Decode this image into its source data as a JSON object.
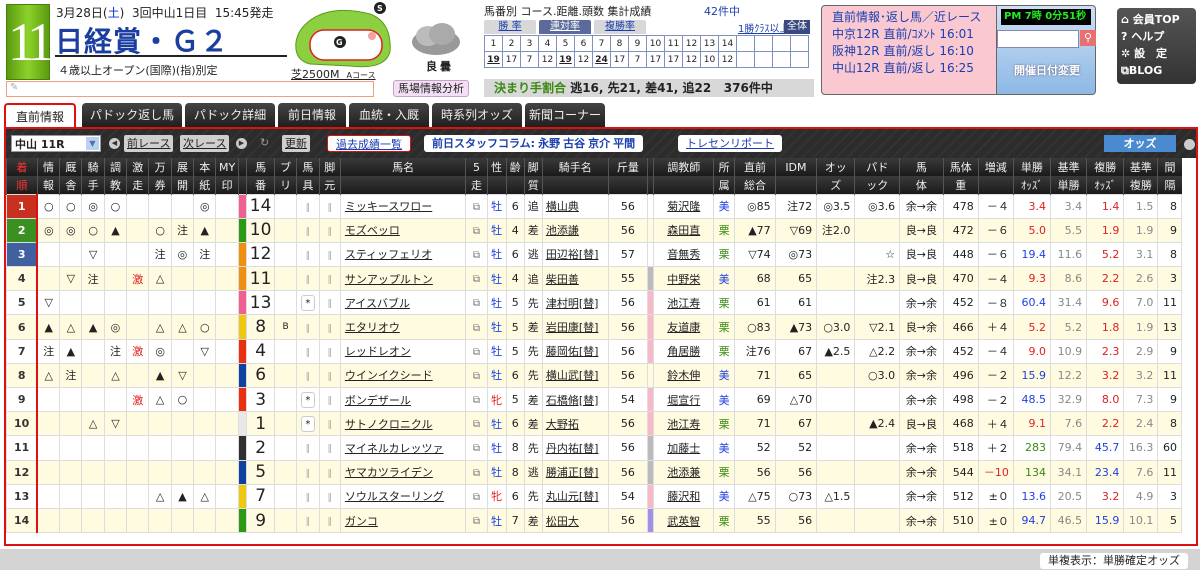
{
  "race": {
    "number": "11",
    "date": "3月28日(",
    "weekday": "土",
    "date_close": ")",
    "meeting": "3回中山1日目",
    "post_time": "15:45発走",
    "name": "日経賞・Ｇ２",
    "condition": "４歳以上オープン(国際)(指)別定",
    "course": "芝2500M",
    "course_sub": "Aコース",
    "track_condition": "良",
    "weather": "曇",
    "track_analysis_label": "馬場情報分析"
  },
  "stats": {
    "title": "馬番別 コース.距離.頭数 集計成績",
    "count": "42件中",
    "tabs": [
      "勝 率",
      "連対率",
      "複勝率"
    ],
    "active_tab": "連対率",
    "class_link": "1勝ｸﾗｽ以上",
    "all_label": "全体",
    "horse_numbers": [
      "1",
      "2",
      "3",
      "4",
      "5",
      "6",
      "7",
      "8",
      "9",
      "10",
      "11",
      "12",
      "13",
      "14",
      "",
      "",
      "",
      ""
    ],
    "values": [
      "19",
      "17",
      "7",
      "12",
      "19",
      "12",
      "24",
      "17",
      "7",
      "17",
      "17",
      "12",
      "10",
      "12",
      "",
      "",
      "",
      ""
    ],
    "underlined": [
      0,
      4,
      6
    ],
    "finish_label": "決まり手割合",
    "finish_values": "逃16, 先21, 差41, 追22",
    "finish_count": "376件中"
  },
  "nearby": {
    "title": "直前情報･返し馬／近レース",
    "races": [
      {
        "race": "中京12R",
        "link1": "直前",
        "link2": "ｺﾒﾝﾄ",
        "time": "16:01"
      },
      {
        "race": "阪神12R",
        "link1": "直前",
        "link2": "返し",
        "time": "16:10"
      },
      {
        "race": "中山12R",
        "link1": "直前",
        "link2": "返し",
        "time": "16:25"
      }
    ]
  },
  "clock": {
    "text": "PM 7時 0分51秒",
    "search_placeholder": "",
    "date_change": "開催日付変更"
  },
  "usermenu": [
    "会員TOP",
    "ヘルプ",
    "設　定",
    "BLOG"
  ],
  "tabs": [
    "直前情報",
    "パドック返し馬",
    "パドック詳細",
    "前日情報",
    "血統・入厩",
    "時系列オッズ",
    "新聞コーナー"
  ],
  "active_tab": "直前情報",
  "toolbar": {
    "race_select": "中山 11R",
    "prev": "前レース",
    "next": "次レース",
    "refresh": "更新",
    "past_results": "過去成績一覧",
    "column_label": "前日スタッフコラム:",
    "column_authors": [
      "永野",
      "古谷",
      "京介",
      "平間"
    ],
    "tracen": "トレセンリポート",
    "odds": "オッズ"
  },
  "table": {
    "headers": [
      [
        "着",
        "順"
      ],
      [
        "情",
        "報"
      ],
      [
        "厩",
        "舎"
      ],
      [
        "騎",
        "手"
      ],
      [
        "調",
        "教"
      ],
      [
        "激",
        "走"
      ],
      [
        "万",
        "券"
      ],
      [
        "展",
        "開"
      ],
      [
        "本",
        "紙"
      ],
      [
        "MY",
        "印"
      ],
      [
        "",
        ""
      ],
      [
        "馬",
        "番"
      ],
      [
        "ブ",
        "リ"
      ],
      [
        "馬",
        "具"
      ],
      [
        "脚",
        "元"
      ],
      [
        "馬名",
        ""
      ],
      [
        "5",
        "走"
      ],
      [
        "性",
        ""
      ],
      [
        "齢",
        ""
      ],
      [
        "脚",
        "質"
      ],
      [
        "騎手名",
        ""
      ],
      [
        "斤量",
        ""
      ],
      [
        "",
        ""
      ],
      [
        "調教師",
        ""
      ],
      [
        "所",
        "属"
      ],
      [
        "直前",
        "総合"
      ],
      [
        "IDM",
        ""
      ],
      [
        "オッ",
        "ズ"
      ],
      [
        "パド",
        "ック"
      ],
      [
        "馬",
        "体"
      ],
      [
        "馬体",
        "重"
      ],
      [
        "増減",
        ""
      ],
      [
        "単勝",
        "ｵｯｽﾞ"
      ],
      [
        "基準",
        "単勝"
      ],
      [
        "複勝",
        "ｵｯｽﾞ"
      ],
      [
        "基準",
        "複勝"
      ],
      [
        "間",
        "隔"
      ]
    ],
    "rows": [
      {
        "rank": "1",
        "info": "○",
        "stable": "○",
        "jockey_mk": "◎",
        "train": "○",
        "geki": "",
        "man": "",
        "ten": "",
        "honshi": "◎",
        "my": "",
        "waku": "#f06090",
        "num": "14",
        "bl": "",
        "gear": "",
        "leg": "",
        "name": "ミッキースワロー",
        "sex": "牡",
        "sexc": "m",
        "age": "6",
        "style": "追",
        "jockey": "横山典",
        "kin": "56",
        "tcolor": "",
        "trainer": "菊沢隆",
        "aff": "美",
        "affc": "m",
        "sogo": "◎85",
        "idm": "注72",
        "odds_mk": "◎3.5",
        "pad": "◎3.6",
        "body": "余→余",
        "wt": "478",
        "diff": "－４",
        "win": "3.4",
        "winc": "red",
        "bwin": "3.4",
        "place": "1.4",
        "placec": "red",
        "bplace": "1.5",
        "interval": "8"
      },
      {
        "rank": "2",
        "info": "◎",
        "stable": "◎",
        "jockey_mk": "○",
        "train": "▲",
        "geki": "",
        "man": "○",
        "ten": "注",
        "honshi": "▲",
        "my": "",
        "waku": "#2a9a10",
        "num": "10",
        "bl": "",
        "gear": "",
        "leg": "",
        "name": "モズベッロ",
        "sex": "牡",
        "sexc": "m",
        "age": "4",
        "style": "差",
        "jockey": "池添謙",
        "kin": "56",
        "tcolor": "",
        "trainer": "森田直",
        "aff": "栗",
        "affc": "r",
        "sogo": "▲77",
        "idm": "▽69",
        "odds_mk": "注2.0",
        "pad": "",
        "body": "良→良",
        "wt": "472",
        "diff": "－６",
        "win": "5.0",
        "winc": "red",
        "bwin": "5.5",
        "place": "1.9",
        "placec": "red",
        "bplace": "1.9",
        "interval": "9"
      },
      {
        "rank": "3",
        "info": "",
        "stable": "",
        "jockey_mk": "▽",
        "train": "",
        "geki": "",
        "man": "注",
        "ten": "◎",
        "honshi": "注",
        "my": "",
        "waku": "#f09010",
        "num": "12",
        "bl": "",
        "gear": "",
        "leg": "",
        "name": "スティッフェリオ",
        "sex": "牡",
        "sexc": "m",
        "age": "6",
        "style": "逃",
        "jockey": "田辺裕[替]",
        "kin": "57",
        "tcolor": "",
        "trainer": "音無秀",
        "aff": "栗",
        "affc": "r",
        "sogo": "▽74",
        "idm": "◎73",
        "odds_mk": "",
        "pad": "☆",
        "body": "良→良",
        "wt": "448",
        "diff": "－６",
        "win": "19.4",
        "winc": "blue",
        "bwin": "11.6",
        "place": "5.2",
        "placec": "red",
        "bplace": "3.1",
        "interval": "8"
      },
      {
        "rank": "4",
        "info": "",
        "stable": "▽",
        "jockey_mk": "注",
        "train": "",
        "geki": "激",
        "man": "△",
        "ten": "",
        "honshi": "",
        "my": "",
        "waku": "#f09010",
        "num": "11",
        "bl": "",
        "gear": "",
        "leg": "",
        "name": "サンアップルトン",
        "sex": "牡",
        "sexc": "m",
        "age": "4",
        "style": "追",
        "jockey": "柴田善",
        "kin": "55",
        "tcolor": "#bbb",
        "trainer": "中野栄",
        "aff": "美",
        "affc": "m",
        "sogo": "68",
        "idm": "65",
        "odds_mk": "",
        "pad": "注2.3",
        "body": "良→良",
        "wt": "470",
        "diff": "－４",
        "win": "9.3",
        "winc": "red",
        "bwin": "8.6",
        "place": "2.2",
        "placec": "red",
        "bplace": "2.6",
        "interval": "3"
      },
      {
        "rank": "5",
        "info": "▽",
        "stable": "",
        "jockey_mk": "",
        "train": "",
        "geki": "",
        "man": "",
        "ten": "",
        "honshi": "",
        "my": "",
        "waku": "#f06090",
        "num": "13",
        "bl": "",
        "gear": "*",
        "leg": "",
        "name": "アイスバブル",
        "sex": "牡",
        "sexc": "m",
        "age": "5",
        "style": "先",
        "jockey": "津村明[替]",
        "kin": "56",
        "tcolor": "#f8b8c8",
        "trainer": "池江寿",
        "aff": "栗",
        "affc": "r",
        "sogo": "61",
        "idm": "61",
        "odds_mk": "",
        "pad": "",
        "body": "余→余",
        "wt": "452",
        "diff": "－８",
        "win": "60.4",
        "winc": "blue",
        "bwin": "31.4",
        "place": "9.6",
        "placec": "red",
        "bplace": "7.0",
        "interval": "11"
      },
      {
        "rank": "6",
        "info": "▲",
        "stable": "△",
        "jockey_mk": "▲",
        "train": "◎",
        "geki": "",
        "man": "△",
        "ten": "△",
        "honshi": "○",
        "my": "",
        "waku": "#f0c810",
        "num": "8",
        "bl": "B",
        "gear": "",
        "leg": "",
        "name": "エタリオウ",
        "sex": "牡",
        "sexc": "m",
        "age": "5",
        "style": "差",
        "jockey": "岩田康[替]",
        "kin": "56",
        "tcolor": "#f8b8c8",
        "trainer": "友道康",
        "aff": "栗",
        "affc": "r",
        "sogo": "○83",
        "idm": "▲73",
        "odds_mk": "○3.0",
        "pad": "▽2.1",
        "body": "良→余",
        "wt": "466",
        "diff": "＋４",
        "win": "5.2",
        "winc": "red",
        "bwin": "5.2",
        "place": "1.8",
        "placec": "red",
        "bplace": "1.9",
        "interval": "13"
      },
      {
        "rank": "7",
        "info": "注",
        "stable": "▲",
        "jockey_mk": "",
        "train": "注",
        "geki": "激",
        "man": "◎",
        "ten": "",
        "honshi": "▽",
        "my": "",
        "waku": "#e83010",
        "num": "4",
        "bl": "",
        "gear": "",
        "leg": "",
        "name": "レッドレオン",
        "sex": "牡",
        "sexc": "m",
        "age": "5",
        "style": "先",
        "jockey": "藤岡佑[替]",
        "kin": "56",
        "tcolor": "#f8b8c8",
        "trainer": "角居勝",
        "aff": "栗",
        "affc": "r",
        "sogo": "注76",
        "idm": "67",
        "odds_mk": "▲2.5",
        "pad": "△2.2",
        "body": "余→余",
        "wt": "452",
        "diff": "－４",
        "win": "9.0",
        "winc": "red",
        "bwin": "10.9",
        "place": "2.3",
        "placec": "red",
        "bplace": "2.9",
        "interval": "9"
      },
      {
        "rank": "8",
        "info": "△",
        "stable": "注",
        "jockey_mk": "",
        "train": "△",
        "geki": "",
        "man": "▲",
        "ten": "▽",
        "honshi": "",
        "my": "",
        "waku": "#1040a0",
        "num": "6",
        "bl": "",
        "gear": "",
        "leg": "",
        "name": "ウインイクシード",
        "sex": "牡",
        "sexc": "m",
        "age": "6",
        "style": "先",
        "jockey": "横山武[替]",
        "kin": "56",
        "tcolor": "",
        "trainer": "鈴木伸",
        "aff": "美",
        "affc": "m",
        "sogo": "71",
        "idm": "65",
        "odds_mk": "",
        "pad": "○3.0",
        "body": "余→余",
        "wt": "496",
        "diff": "－２",
        "win": "15.9",
        "winc": "blue",
        "bwin": "12.2",
        "place": "3.2",
        "placec": "red",
        "bplace": "3.2",
        "interval": "11"
      },
      {
        "rank": "9",
        "info": "",
        "stable": "",
        "jockey_mk": "",
        "train": "",
        "geki": "激",
        "man": "△",
        "ten": "○",
        "honshi": "",
        "my": "",
        "waku": "#e83010",
        "num": "3",
        "bl": "",
        "gear": "*",
        "leg": "",
        "name": "ボンデザール",
        "sex": "牝",
        "sexc": "f",
        "age": "5",
        "style": "差",
        "jockey": "石橋脩[替]",
        "kin": "54",
        "tcolor": "#f8b8c8",
        "trainer": "堀宣行",
        "aff": "美",
        "affc": "m",
        "sogo": "69",
        "idm": "△70",
        "odds_mk": "",
        "pad": "",
        "body": "余→余",
        "wt": "498",
        "diff": "－２",
        "win": "48.5",
        "winc": "blue",
        "bwin": "32.9",
        "place": "8.0",
        "placec": "red",
        "bplace": "7.3",
        "interval": "9"
      },
      {
        "rank": "10",
        "info": "",
        "stable": "",
        "jockey_mk": "△",
        "train": "▽",
        "geki": "",
        "man": "",
        "ten": "",
        "honshi": "",
        "my": "",
        "waku": "#e8e8e8",
        "num": "1",
        "bl": "",
        "gear": "*",
        "leg": "",
        "name": "サトノクロニクル",
        "sex": "牡",
        "sexc": "m",
        "age": "6",
        "style": "差",
        "jockey": "大野拓",
        "kin": "56",
        "tcolor": "#f8b8c8",
        "trainer": "池江寿",
        "aff": "栗",
        "affc": "r",
        "sogo": "71",
        "idm": "67",
        "odds_mk": "",
        "pad": "▲2.4",
        "body": "良→良",
        "wt": "468",
        "diff": "＋４",
        "win": "9.1",
        "winc": "red",
        "bwin": "7.6",
        "place": "2.2",
        "placec": "red",
        "bplace": "2.4",
        "interval": "8"
      },
      {
        "rank": "11",
        "info": "",
        "stable": "",
        "jockey_mk": "",
        "train": "",
        "geki": "",
        "man": "",
        "ten": "",
        "honshi": "",
        "my": "",
        "waku": "#303030",
        "num": "2",
        "bl": "",
        "gear": "",
        "leg": "",
        "name": "マイネルカレッツァ",
        "sex": "牡",
        "sexc": "m",
        "age": "8",
        "style": "先",
        "jockey": "丹内祐[替]",
        "kin": "56",
        "tcolor": "#bbb",
        "trainer": "加藤士",
        "aff": "美",
        "affc": "m",
        "sogo": "52",
        "idm": "52",
        "odds_mk": "",
        "pad": "",
        "body": "余→余",
        "wt": "518",
        "diff": "＋２",
        "win": "283",
        "winc": "green",
        "bwin": "79.4",
        "place": "45.7",
        "placec": "blue",
        "bplace": "16.3",
        "interval": "60"
      },
      {
        "rank": "12",
        "info": "",
        "stable": "",
        "jockey_mk": "",
        "train": "",
        "geki": "",
        "man": "",
        "ten": "",
        "honshi": "",
        "my": "",
        "waku": "#1040a0",
        "num": "5",
        "bl": "",
        "gear": "",
        "leg": "",
        "name": "ヤマカツライデン",
        "sex": "牡",
        "sexc": "m",
        "age": "8",
        "style": "逃",
        "jockey": "勝浦正[替]",
        "kin": "56",
        "tcolor": "#bbb",
        "trainer": "池添兼",
        "aff": "栗",
        "affc": "r",
        "sogo": "56",
        "idm": "56",
        "odds_mk": "",
        "pad": "",
        "body": "余→余",
        "wt": "544",
        "diff": "－10",
        "diffc": "red",
        "win": "134",
        "winc": "green",
        "bwin": "34.1",
        "place": "23.4",
        "placec": "blue",
        "bplace": "7.6",
        "interval": "11"
      },
      {
        "rank": "13",
        "info": "",
        "stable": "",
        "jockey_mk": "",
        "train": "",
        "geki": "",
        "man": "△",
        "ten": "▲",
        "honshi": "△",
        "my": "",
        "waku": "#f0c810",
        "num": "7",
        "bl": "",
        "gear": "",
        "leg": "",
        "name": "ソウルスターリング",
        "sex": "牝",
        "sexc": "f",
        "age": "6",
        "style": "先",
        "jockey": "丸山元[替]",
        "kin": "54",
        "tcolor": "#f8b8c8",
        "trainer": "藤沢和",
        "aff": "美",
        "affc": "m",
        "sogo": "△75",
        "idm": "○73",
        "odds_mk": "△1.5",
        "pad": "",
        "body": "余→余",
        "wt": "512",
        "diff": "±０",
        "win": "13.6",
        "winc": "blue",
        "bwin": "20.5",
        "place": "3.2",
        "placec": "red",
        "bplace": "4.9",
        "interval": "3"
      },
      {
        "rank": "14",
        "info": "",
        "stable": "",
        "jockey_mk": "",
        "train": "",
        "geki": "",
        "man": "",
        "ten": "",
        "honshi": "",
        "my": "",
        "waku": "#2a9a10",
        "num": "9",
        "bl": "",
        "gear": "",
        "leg": "",
        "name": "ガンコ",
        "sex": "牡",
        "sexc": "m",
        "age": "7",
        "style": "差",
        "jockey": "松田大",
        "kin": "56",
        "tcolor": "#a090e8",
        "trainer": "武英智",
        "aff": "栗",
        "affc": "r",
        "sogo": "55",
        "idm": "56",
        "odds_mk": "",
        "pad": "",
        "body": "余→余",
        "wt": "510",
        "diff": "±０",
        "win": "94.7",
        "winc": "blue",
        "bwin": "46.5",
        "place": "15.9",
        "placec": "blue",
        "bplace": "10.1",
        "interval": "5"
      }
    ]
  },
  "footer": {
    "note": "単複表示：単勝確定オッズ"
  }
}
